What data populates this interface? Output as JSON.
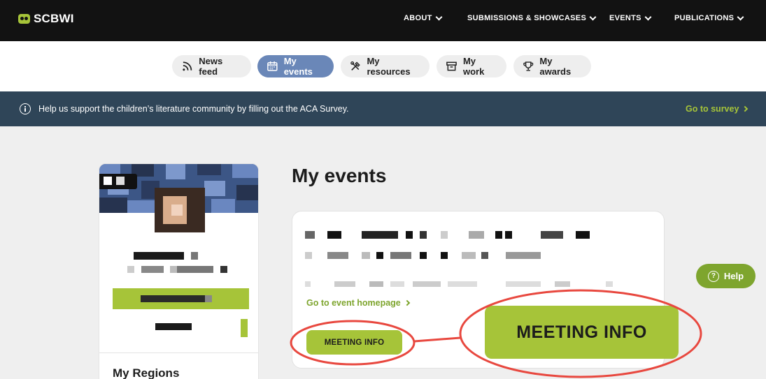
{
  "brand": {
    "name": "SCBWI",
    "accent": "#a6c439"
  },
  "nav": {
    "items": [
      {
        "label": "ABOUT"
      },
      {
        "label": "SUBMISSIONS & SHOWCASES"
      },
      {
        "label": "EVENTS"
      },
      {
        "label": "PUBLICATIONS"
      }
    ]
  },
  "tabs": [
    {
      "label": "News feed",
      "icon": "rss-icon"
    },
    {
      "label": "My events",
      "icon": "calendar-icon",
      "active": true
    },
    {
      "label": "My resources",
      "icon": "tools-icon"
    },
    {
      "label": "My work",
      "icon": "archive-icon"
    },
    {
      "label": "My awards",
      "icon": "trophy-icon"
    }
  ],
  "banner": {
    "text": "Help us support the children’s literature community by filling out the ACA Survey.",
    "link": "Go to survey"
  },
  "profile": {
    "regions_title": "My Regions"
  },
  "main": {
    "title": "My events",
    "event": {
      "homepage_link": "Go to event homepage",
      "meeting_button": "MEETING INFO"
    },
    "callout": {
      "meeting_button": "MEETING INFO",
      "highlight_color": "#e8483f"
    }
  },
  "help": {
    "label": "Help"
  }
}
